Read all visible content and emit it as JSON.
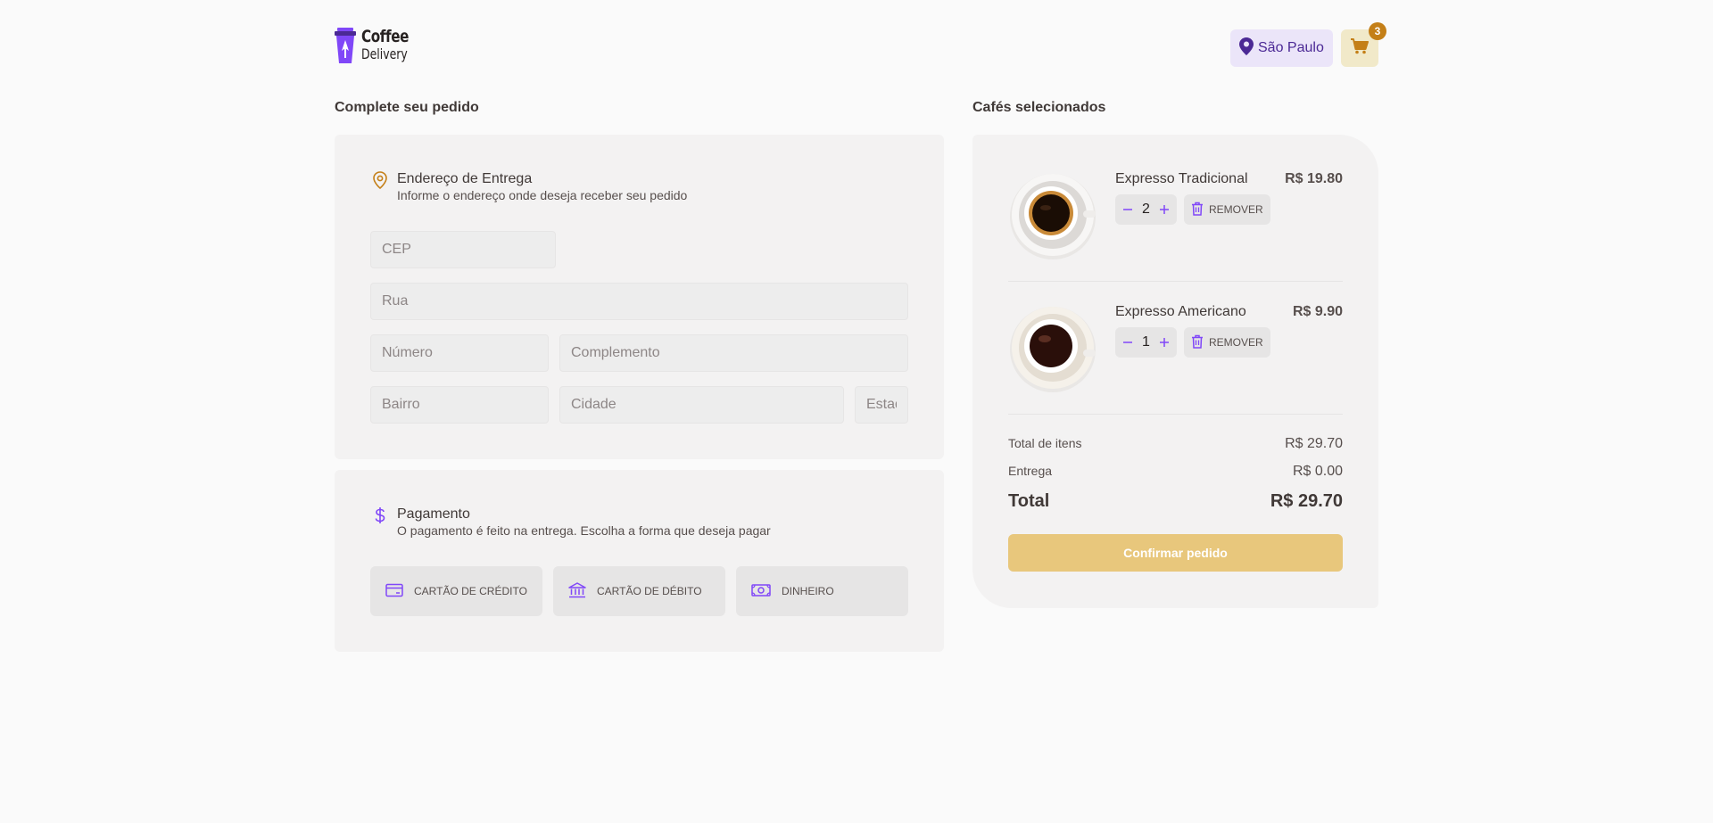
{
  "header": {
    "logo": {
      "line1": "Coffee",
      "line2": "Delivery"
    },
    "location": "São Paulo",
    "cart_count": "3"
  },
  "checkout": {
    "title": "Complete seu pedido",
    "address": {
      "heading": "Endereço de Entrega",
      "subheading": "Informe o endereço onde deseja receber seu pedido",
      "placeholders": {
        "cep": "CEP",
        "rua": "Rua",
        "numero": "Número",
        "complemento": "Complemento",
        "bairro": "Bairro",
        "cidade": "Cidade",
        "estado": "Estado"
      }
    },
    "payment": {
      "heading": "Pagamento",
      "subheading": "O pagamento é feito na entrega. Escolha a forma que deseja pagar",
      "options": [
        "CARTÃO DE CRÉDITO",
        "CARTÃO DE DÉBITO",
        "DINHEIRO"
      ]
    }
  },
  "cart": {
    "title": "Cafés selecionados",
    "items": [
      {
        "name": "Expresso Tradicional",
        "price": "R$ 19.80",
        "quantity": "2",
        "remove_label": "REMOVER"
      },
      {
        "name": "Expresso Americano",
        "price": "R$ 9.90",
        "quantity": "1",
        "remove_label": "REMOVER"
      }
    ],
    "summary": {
      "items_label": "Total de itens",
      "items_value": "R$ 29.70",
      "delivery_label": "Entrega",
      "delivery_value": "R$ 0.00",
      "total_label": "Total",
      "total_value": "R$ 29.70"
    },
    "confirm_label": "Confirmar pedido"
  },
  "colors": {
    "purple": "#8047f8",
    "purple_dark": "#4b2995",
    "yellow": "#dbac2c",
    "yellow_dark": "#c47f17",
    "yellow_light": "#e8c77c"
  }
}
